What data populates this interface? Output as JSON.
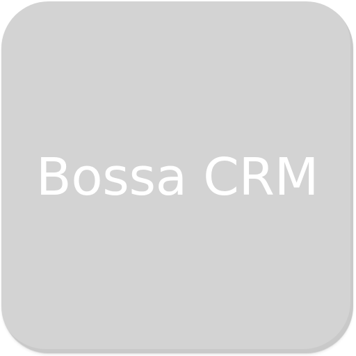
{
  "app_icon": {
    "name": "Bossa CRM",
    "tile_color": "#d3d3d3",
    "text_color": "#ffffff"
  }
}
